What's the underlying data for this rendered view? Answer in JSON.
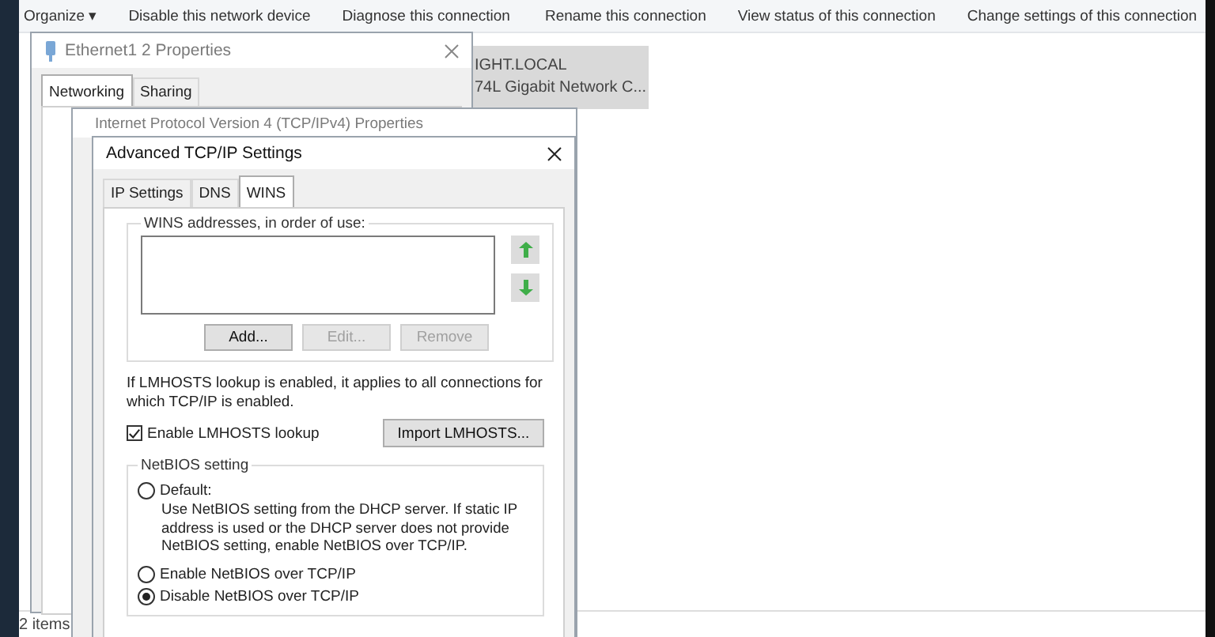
{
  "explorer": {
    "toolbar": [
      "Organize ▾",
      "Disable this network device",
      "Diagnose this connection",
      "Rename this connection",
      "View status of this connection",
      "Change settings of this connection"
    ],
    "selected_item": {
      "lines": [
        "IGHT.LOCAL",
        "74L Gigabit Network C..."
      ]
    },
    "status_bar": "2 items"
  },
  "properties_window": {
    "title": "Ethernet1 2 Properties",
    "tabs": [
      {
        "label": "Networking",
        "selected": true
      },
      {
        "label": "Sharing",
        "selected": false
      }
    ]
  },
  "ipv4_window": {
    "title": "Internet Protocol Version 4 (TCP/IPv4) Properties"
  },
  "advanced_window": {
    "title": "Advanced TCP/IP Settings",
    "tabs": [
      {
        "label": "IP Settings",
        "selected": false
      },
      {
        "label": "DNS",
        "selected": false
      },
      {
        "label": "WINS",
        "selected": true
      }
    ],
    "wins_group": {
      "label": "WINS addresses, in order of use:",
      "buttons": [
        {
          "label": "Add...",
          "disabled": false
        },
        {
          "label": "Edit...",
          "disabled": true
        },
        {
          "label": "Remove",
          "disabled": true
        }
      ]
    },
    "lmhosts_note": "If LMHOSTS lookup is enabled, it applies to all connections for which TCP/IP is enabled.",
    "lmhosts_checkbox": {
      "label": "Enable LMHOSTS lookup",
      "checked": true
    },
    "import_button": "Import LMHOSTS...",
    "netbios": {
      "label": "NetBIOS setting",
      "options": [
        {
          "label": "Default:",
          "description": "Use NetBIOS setting from the DHCP server. If static IP address is used or the DHCP server does not provide NetBIOS setting, enable NetBIOS over TCP/IP.",
          "selected": false
        },
        {
          "label": "Enable NetBIOS over TCP/IP",
          "selected": false
        },
        {
          "label": "Disable NetBIOS over TCP/IP",
          "selected": true
        }
      ]
    }
  }
}
